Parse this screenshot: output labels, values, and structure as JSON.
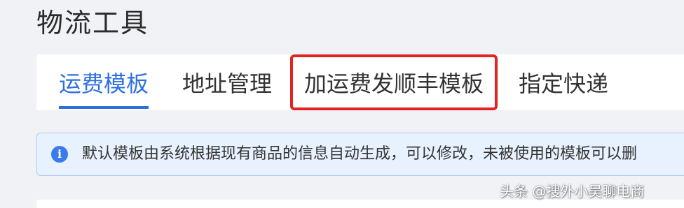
{
  "page": {
    "title": "物流工具"
  },
  "tabs": [
    {
      "label": "运费模板",
      "active": true
    },
    {
      "label": "地址管理",
      "active": false
    },
    {
      "label": "加运费发顺丰模板",
      "active": false,
      "highlighted": true
    },
    {
      "label": "指定快递",
      "active": false
    }
  ],
  "notice": {
    "icon": "info-icon",
    "text": "默认模板由系统根据现有商品的信息自动生成，可以修改，未被使用的模板可以删"
  },
  "watermark": {
    "text": "头条 @搜外小吴聊电商"
  },
  "colors": {
    "accent": "#2e6fe0",
    "highlight_border": "#e32222",
    "notice_bg": "#e8f1fe",
    "page_bg": "#f1f2f5"
  }
}
